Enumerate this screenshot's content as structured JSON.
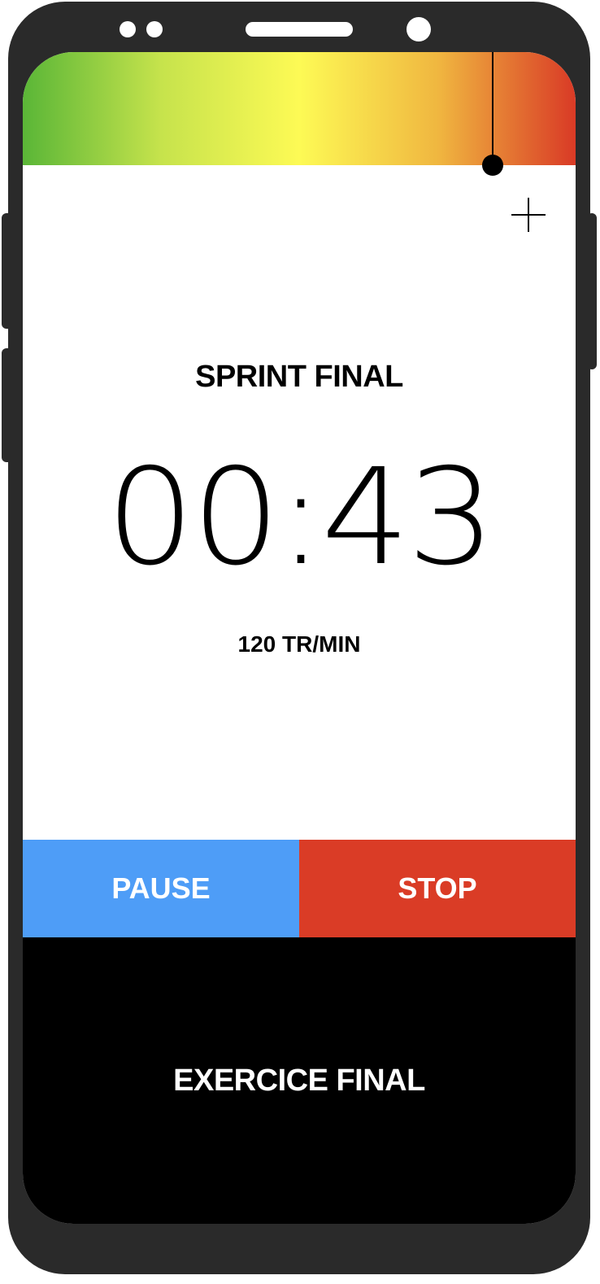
{
  "intensity": {
    "gradient_colors": [
      "#5ab637",
      "#c6e34c",
      "#fdfa55",
      "#f0b740",
      "#d93a26"
    ],
    "marker_level": 0.85
  },
  "toolbar": {
    "add_icon": "plus-icon"
  },
  "workout": {
    "exercise_name": "SPRINT FINAL",
    "timer": "00:43",
    "cadence": "120 TR/MIN"
  },
  "actions": {
    "pause_label": "PAUSE",
    "stop_label": "STOP",
    "pause_color": "#4e9df7",
    "stop_color": "#da3c26"
  },
  "next_exercise": {
    "label": "EXERCICE FINAL"
  }
}
